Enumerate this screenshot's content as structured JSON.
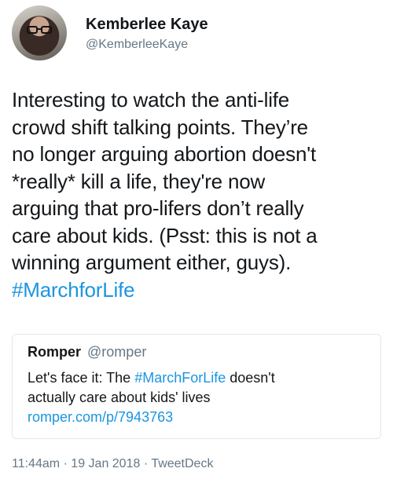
{
  "author": {
    "name": "Kemberlee Kaye",
    "handle": "@KemberleeKaye"
  },
  "tweet": {
    "lines": [
      "Interesting to watch the anti-life",
      "crowd shift talking points. They’re",
      "no longer arguing abortion doesn't",
      "*really* kill a life, they're now",
      "arguing that pro-lifers don’t really",
      "care about kids. (Psst: this is not a",
      "winning argument either, guys)."
    ],
    "hashtag": "#MarchforLife"
  },
  "quoted_tweet": {
    "name": "Romper",
    "handle": "@romper",
    "text_before": "Let's face it: The ",
    "hashtag": "#MarchForLife",
    "text_after": " doesn't",
    "line2": "actually care about kids' lives",
    "link": "romper.com/p/7943763"
  },
  "meta": {
    "time": "11:44am",
    "sep1": " · ",
    "date": "19 Jan 2018",
    "sep2": " · ",
    "source": "TweetDeck"
  }
}
